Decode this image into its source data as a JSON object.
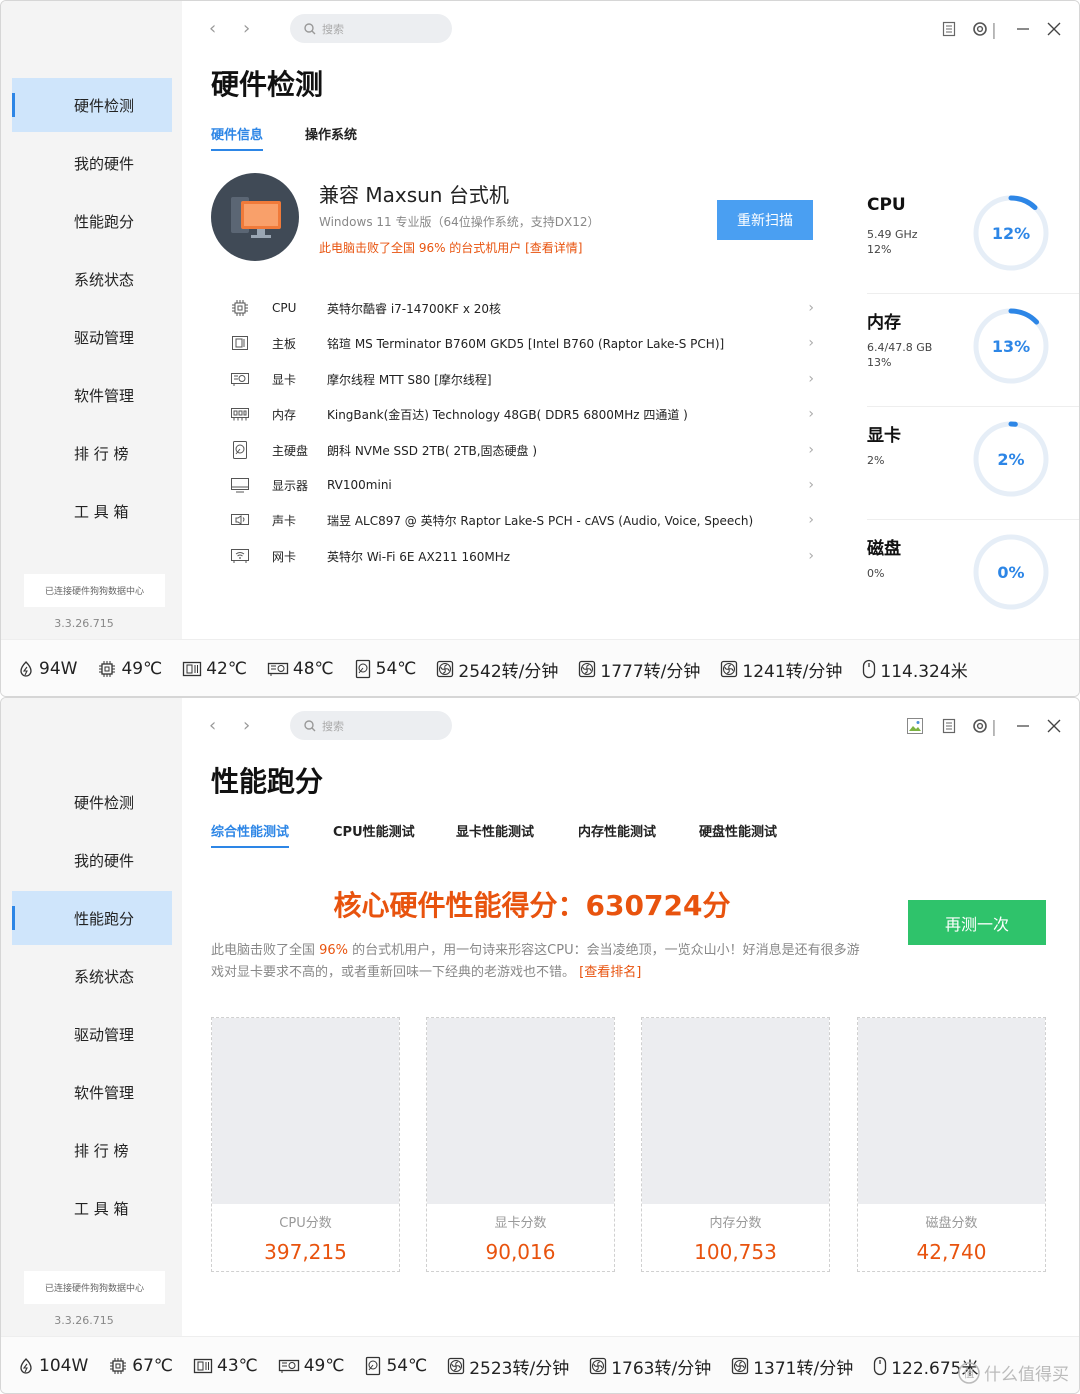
{
  "windows": [
    {
      "id": "w1",
      "sidebar": {
        "items": [
          "硬件检测",
          "我的硬件",
          "性能跑分",
          "系统状态",
          "驱动管理",
          "软件管理",
          "排 行 榜",
          "工 具 箱"
        ],
        "active": 0,
        "connected": "已连接硬件狗狗数据中心",
        "version": "3.3.26.715"
      },
      "search_placeholder": "搜索",
      "title": "硬件检测",
      "tabs": [
        "硬件信息",
        "操作系统"
      ],
      "pc": {
        "name": "兼容 Maxsun 台式机",
        "sub": "Windows 11 专业版（64位操作系统，支持DX12）",
        "rank": "此电脑击败了全国 96% 的台式机用户 [查看详情]",
        "rescan": "重新扫描"
      },
      "hardware": [
        {
          "icon": "cpu-icon",
          "label": "CPU",
          "value": "英特尔酷睿 i7-14700KF x 20核"
        },
        {
          "icon": "motherboard-icon",
          "label": "主板",
          "value": "铭瑄 MS Terminator B760M GKD5 [Intel B760 (Raptor Lake-S PCH)]"
        },
        {
          "icon": "gpu-icon",
          "label": "显卡",
          "value": "摩尔线程 MTT S80 [摩尔线程]"
        },
        {
          "icon": "memory-icon",
          "label": "内存",
          "value": "KingBank(金百达) Technology 48GB( DDR5 6800MHz 四通道 )"
        },
        {
          "icon": "harddisk-icon",
          "label": "主硬盘",
          "value": "朗科 NVMe SSD 2TB( 2TB,固态硬盘 )"
        },
        {
          "icon": "monitor-icon",
          "label": "显示器",
          "value": "RV100mini"
        },
        {
          "icon": "soundcard-icon",
          "label": "声卡",
          "value": "瑞昱 ALC897 @ 英特尔 Raptor Lake-S PCH - cAVS (Audio, Voice, Speech)"
        },
        {
          "icon": "network-icon",
          "label": "网卡",
          "value": "英特尔 Wi-Fi 6E AX211 160MHz"
        }
      ],
      "gauges": [
        {
          "title": "CPU",
          "line1": "5.49 GHz",
          "line2": "12%",
          "pct": "12%",
          "level": 0.12
        },
        {
          "title": "内存",
          "line1": "6.4/47.8 GB",
          "line2": "13%",
          "pct": "13%",
          "level": 0.13
        },
        {
          "title": "显卡",
          "line1": "2%",
          "line2": "",
          "pct": "2%",
          "level": 0.02
        },
        {
          "title": "磁盘",
          "line1": "0%",
          "line2": "",
          "pct": "0%",
          "level": 0.0
        }
      ],
      "status": [
        {
          "icon": "power-icon",
          "value": "94W"
        },
        {
          "icon": "cpu-temp-icon",
          "value": "49℃"
        },
        {
          "icon": "board-temp-icon",
          "value": "42℃"
        },
        {
          "icon": "gpu-temp-icon",
          "value": "48℃"
        },
        {
          "icon": "disk-temp-icon",
          "value": "54℃"
        },
        {
          "icon": "fan-icon",
          "value": "2542转/分钟"
        },
        {
          "icon": "fan-icon",
          "value": "1777转/分钟"
        },
        {
          "icon": "fan-icon",
          "value": "1241转/分钟"
        },
        {
          "icon": "mouse-icon",
          "value": "114.324米"
        }
      ]
    },
    {
      "id": "w2",
      "sidebar": {
        "items": [
          "硬件检测",
          "我的硬件",
          "性能跑分",
          "系统状态",
          "驱动管理",
          "软件管理",
          "排 行 榜",
          "工 具 箱"
        ],
        "active": 2,
        "connected": "已连接硬件狗狗数据中心",
        "version": "3.3.26.715"
      },
      "search_placeholder": "搜索",
      "title": "性能跑分",
      "tabs": [
        "综合性能测试",
        "CPU性能测试",
        "显卡性能测试",
        "内存性能测试",
        "硬盘性能测试"
      ],
      "score": "核心硬件性能得分：630724分",
      "retest": "再测一次",
      "desc_a": "此电脑击败了全国 ",
      "desc_hl": "96%",
      "desc_b": " 的台式机用户，用一句诗来形容这CPU：会当凌绝顶，一览众山小！好消息是还有很多游戏对显卡要求不高的，或者重新回味一下经典的老游戏也不错。 ",
      "desc_link": "[查看排名]",
      "cards": [
        {
          "label": "CPU分数",
          "value": "397,215"
        },
        {
          "label": "显卡分数",
          "value": "90,016"
        },
        {
          "label": "内存分数",
          "value": "100,753"
        },
        {
          "label": "磁盘分数",
          "value": "42,740"
        }
      ],
      "status": [
        {
          "icon": "power-icon",
          "value": "104W"
        },
        {
          "icon": "cpu-temp-icon",
          "value": "67℃"
        },
        {
          "icon": "board-temp-icon",
          "value": "43℃"
        },
        {
          "icon": "gpu-temp-icon",
          "value": "49℃"
        },
        {
          "icon": "disk-temp-icon",
          "value": "54℃"
        },
        {
          "icon": "fan-icon",
          "value": "2523转/分钟"
        },
        {
          "icon": "fan-icon",
          "value": "1763转/分钟"
        },
        {
          "icon": "fan-icon",
          "value": "1371转/分钟"
        },
        {
          "icon": "mouse-icon",
          "value": "122.675米"
        }
      ],
      "watermark": "什么值得买"
    }
  ]
}
